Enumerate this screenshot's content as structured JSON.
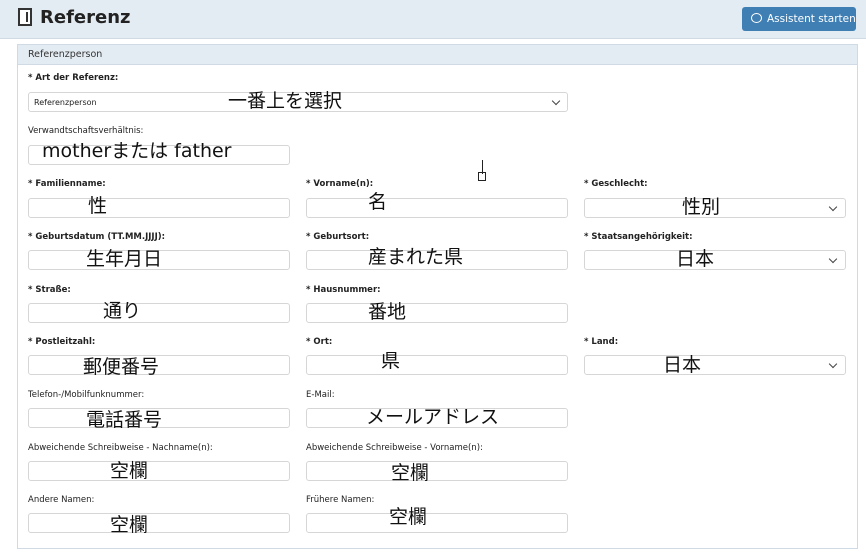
{
  "header": {
    "title": "Referenz",
    "assistant_button": "Assistent starten"
  },
  "panel": {
    "title": "Referenzperson"
  },
  "fields": {
    "art": {
      "label": "* Art der Referenz:",
      "selected": "Referenzperson",
      "annotation": "一番上を選択"
    },
    "verwandtschaft": {
      "label": "Verwandtschaftsverhältnis:",
      "value": "motherまたは father"
    },
    "familienname": {
      "label": "* Familienname:",
      "value": "性"
    },
    "vorname": {
      "label": "* Vorname(n):",
      "value": "名"
    },
    "geschlecht": {
      "label": "* Geschlecht:",
      "value": "性別"
    },
    "geburtsdatum": {
      "label": "* Geburtsdatum (TT.MM.JJJJ):",
      "value": "生年月日"
    },
    "geburtsort": {
      "label": "* Geburtsort:",
      "value": "産まれた県"
    },
    "staatsangehoerigkeit": {
      "label": "* Staatsangehörigkeit:",
      "value": "日本"
    },
    "strasse": {
      "label": "* Straße:",
      "value": "通り"
    },
    "hausnummer": {
      "label": "* Hausnummer:",
      "value": "番地"
    },
    "postleitzahl": {
      "label": "* Postleitzahl:",
      "value": "郵便番号"
    },
    "ort": {
      "label": "* Ort:",
      "value": "県"
    },
    "land": {
      "label": "* Land:",
      "value": "日本"
    },
    "telefon": {
      "label": "Telefon-/Mobilfunknummer:",
      "value": "電話番号"
    },
    "email": {
      "label": "E-Mail:",
      "value": "メールアドレス"
    },
    "abw_nachname": {
      "label": "Abweichende Schreibweise - Nachname(n):",
      "value": "空欄"
    },
    "abw_vorname": {
      "label": "Abweichende Schreibweise - Vorname(n):",
      "value": "空欄"
    },
    "andere_namen": {
      "label": "Andere Namen:",
      "value": "空欄"
    },
    "fruehere_namen": {
      "label": "Frühere Namen:",
      "value": "空欄"
    }
  },
  "icons": {
    "header": "document-icon",
    "assistant": "chat-bubble-icon",
    "dropdown": "chevron-down-icon"
  }
}
